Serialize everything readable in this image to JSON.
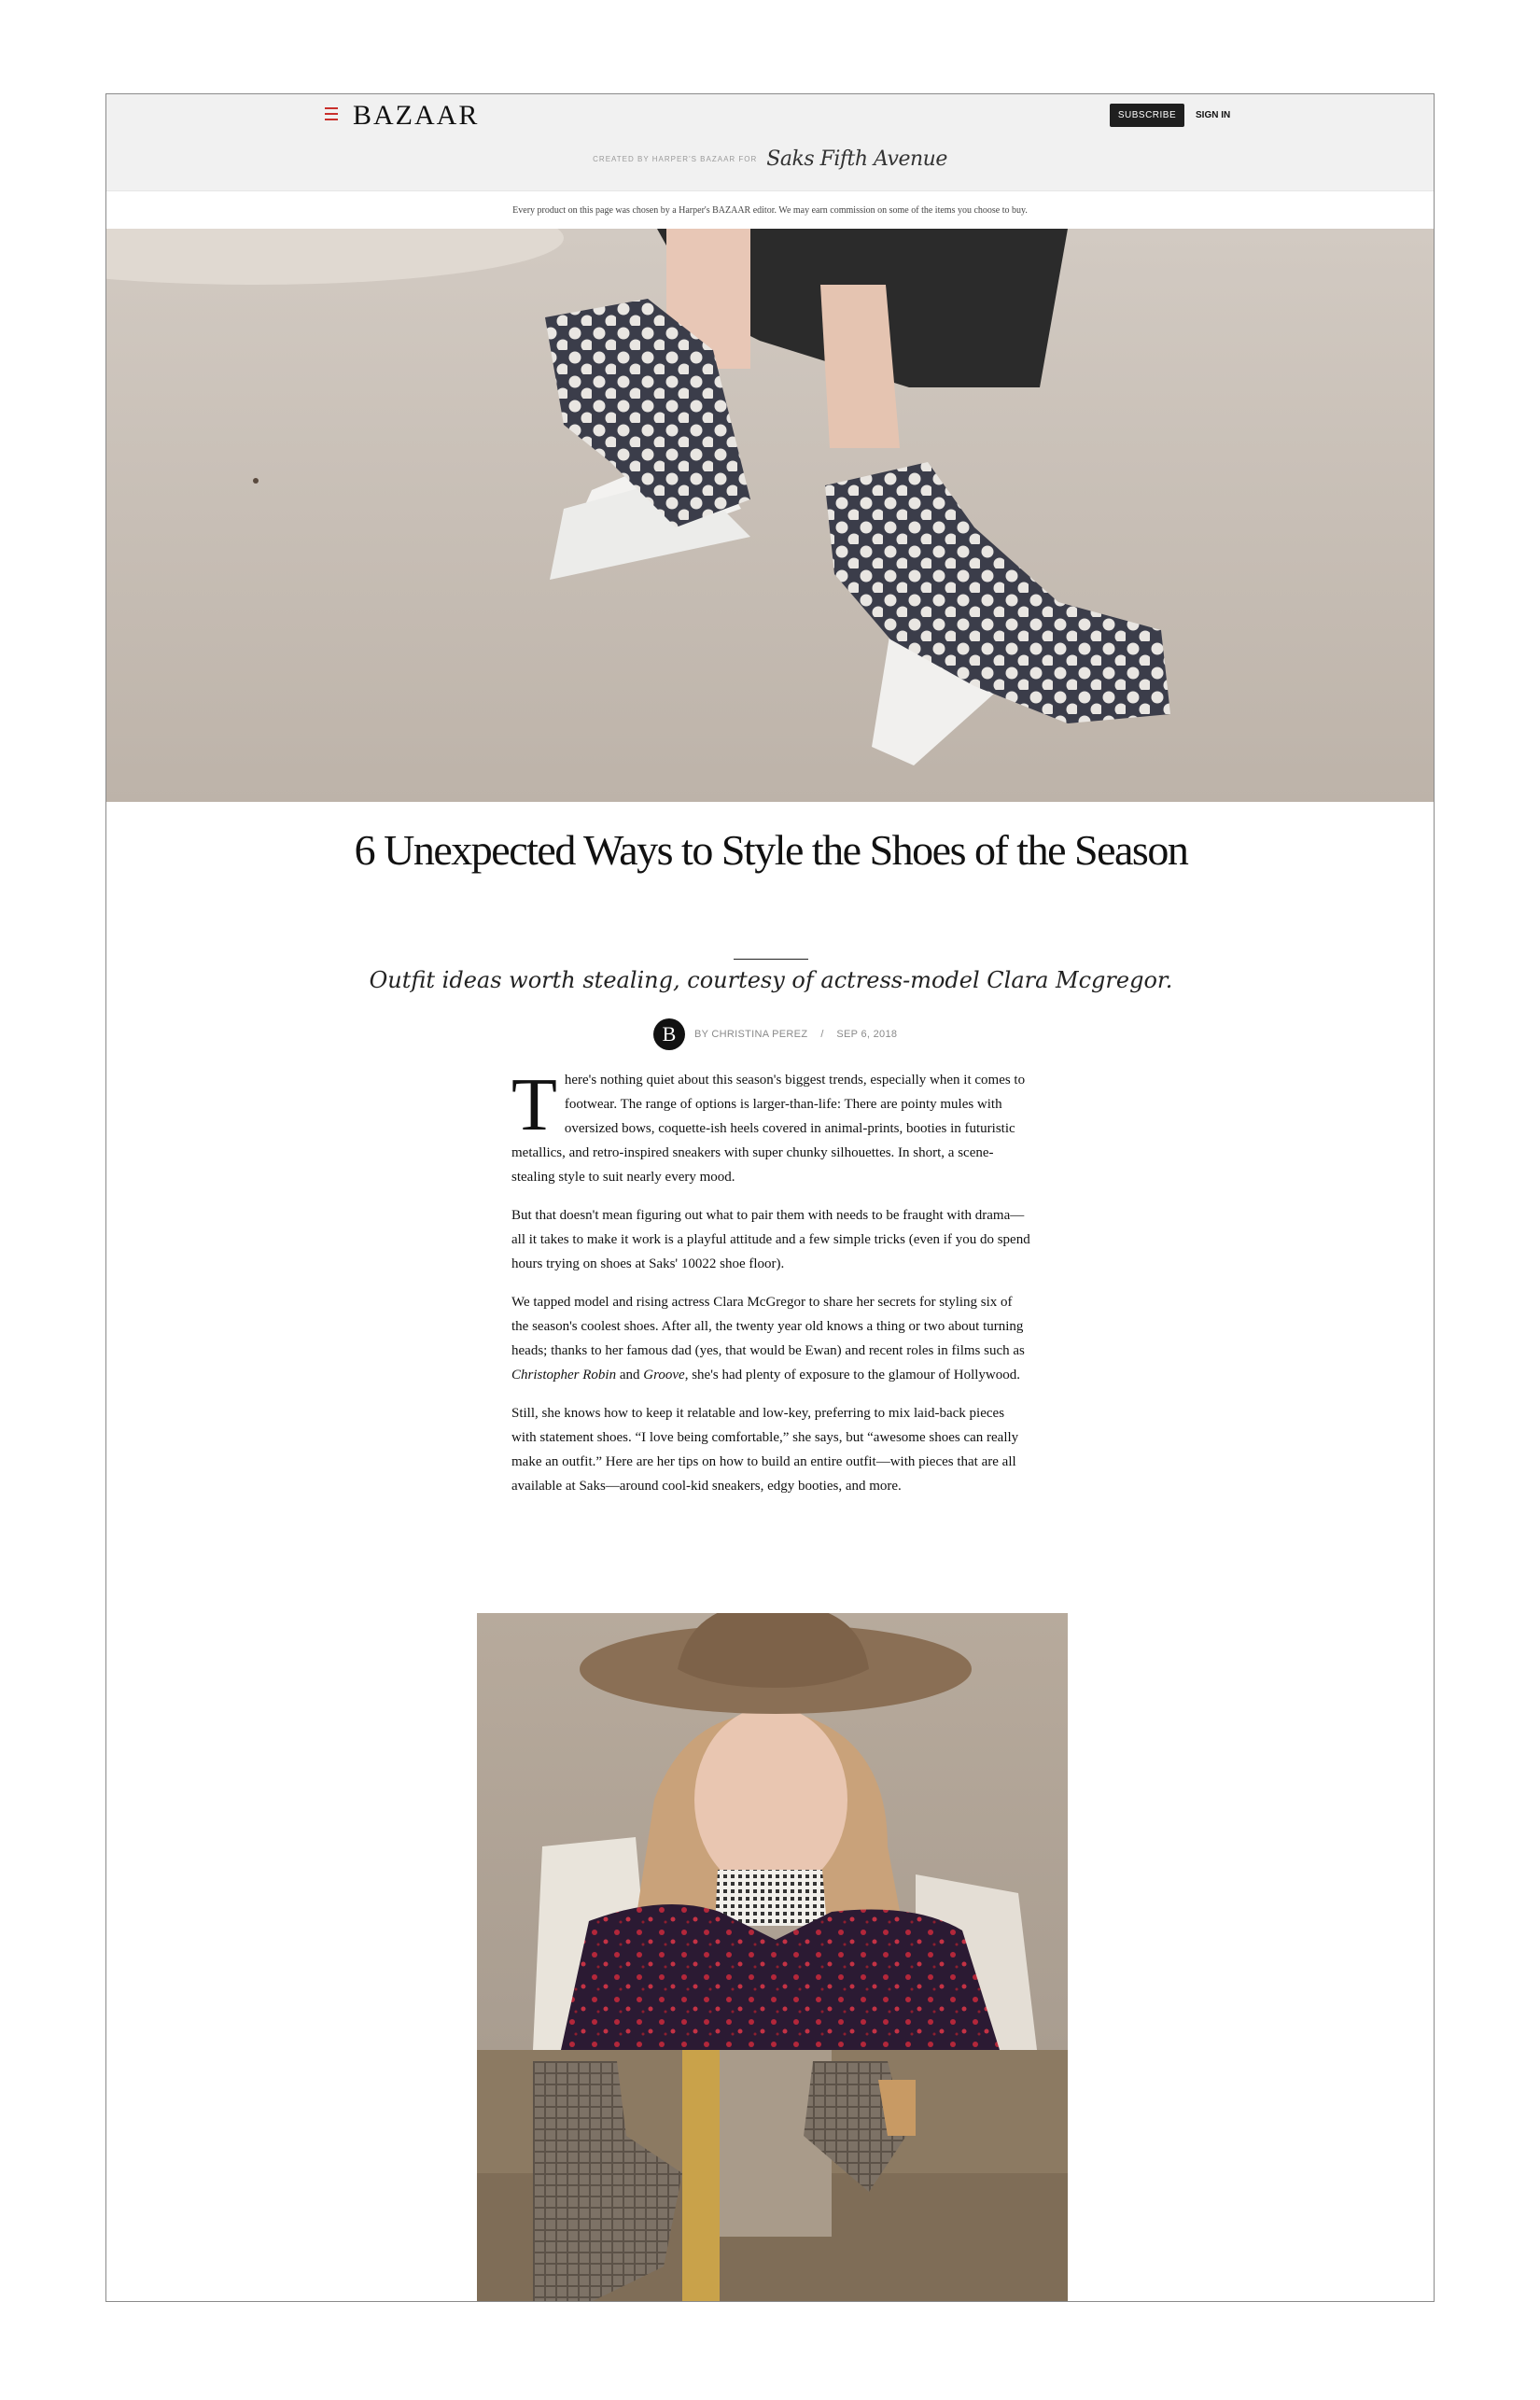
{
  "header": {
    "logo": "BAZAAR",
    "subscribe_label": "SUBSCRIBE",
    "signin_label": "SIGN IN",
    "partner_label": "CREATED BY HARPER'S BAZAAR FOR",
    "partner_logo": "Saks Fifth Avenue",
    "menu_icon": "hamburger-icon"
  },
  "disclaimer": "Every product on this page was chosen by a Harper's BAZAAR editor. We may earn commission on some of the items you choose to buy.",
  "article": {
    "title": "6 Unexpected Ways to Style the Shoes of the Season",
    "dek": "Outfit ideas worth stealing, courtesy of actress-model Clara Mcgregor.",
    "avatar_letter": "B",
    "author": "BY CHRISTINA PEREZ",
    "separator": "/",
    "date": "SEP 6, 2018",
    "p1_dropcap": "T",
    "p1": "here's nothing quiet about this season's biggest trends, especially when it comes to footwear. The range of options is larger-than-life: There are pointy mules with oversized bows, coquette-ish heels covered in animal-prints, booties in futuristic metallics, and retro-inspired sneakers with super chunky silhouettes. In short, a scene-stealing style to suit nearly every mood.",
    "p2": "But that doesn't mean figuring out what to pair them with needs to be fraught with drama—all it takes to make it work is a playful attitude and a few simple tricks (even if you do spend hours trying on shoes at Saks' 10022 shoe floor).",
    "p3_a": "We tapped model and rising actress Clara McGregor to share her secrets for styling six of the season's coolest shoes. After all, the twenty year old knows a thing or two about turning heads; thanks to her famous dad (yes, that would be Ewan) and recent roles in films such as ",
    "p3_film1": "Christopher Robin",
    "p3_and": " and ",
    "p3_film2": "Groove",
    "p3_b": ", she's had plenty of exposure to the glamour of Hollywood.",
    "p4": "Still, she knows how to keep it relatable and low-key, preferring to mix laid-back pieces with statement shoes. “I love being comfortable,” she says, but “awesome shoes can really make an outfit.” Here are her tips on how to build an entire outfit—with pieces that are all available at Saks—around cool-kid sneakers, edgy booties, and more."
  }
}
